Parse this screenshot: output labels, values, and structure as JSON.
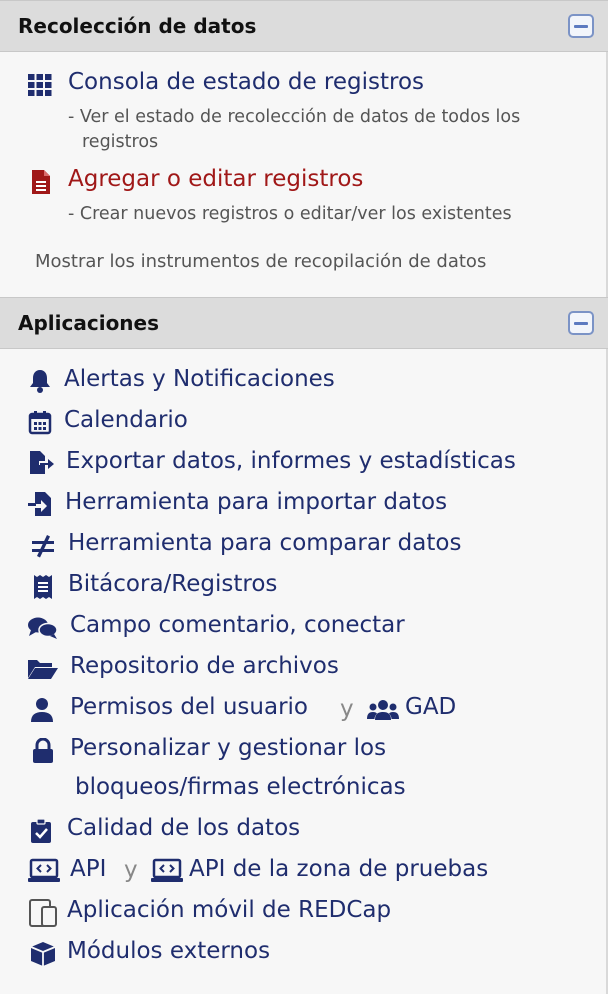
{
  "data_collection": {
    "title": "Recolección de datos",
    "record_status_dashboard": {
      "label": "Consola de estado de registros",
      "description": "- Ver el estado de recolección de datos de todos los registros"
    },
    "add_edit_records": {
      "label": "Agregar o editar registros",
      "description": "- Crear nuevos registros o editar/ver los existentes"
    },
    "show_instruments": "Mostrar los instrumentos de recopilación de datos"
  },
  "applications": {
    "title": "Aplicaciones",
    "alerts": "Alertas y Notificaciones",
    "calendar": "Calendario",
    "export": "Exportar datos, informes y estadísticas",
    "import": "Herramienta para importar datos",
    "compare": "Herramienta para comparar datos",
    "logging": "Bitácora/Registros",
    "field_comment": "Campo comentario, conectar",
    "file_repository": "Repositorio de archivos",
    "user_rights": "Permisos del usuario",
    "conjunction": "y",
    "dag": "GAD",
    "locking_line1": "Personalizar y gestionar los",
    "locking_line2": "bloqueos/firmas electrónicas",
    "data_quality": "Calidad de los datos",
    "api": "API",
    "api_playground": "API de la zona de pruebas",
    "mobile_app": "Aplicación móvil de REDCap",
    "external_modules": "Módulos externos"
  },
  "colors": {
    "link": "#1f2d6e",
    "link_red": "#a01818",
    "header_bg": "#dcdcdc"
  }
}
